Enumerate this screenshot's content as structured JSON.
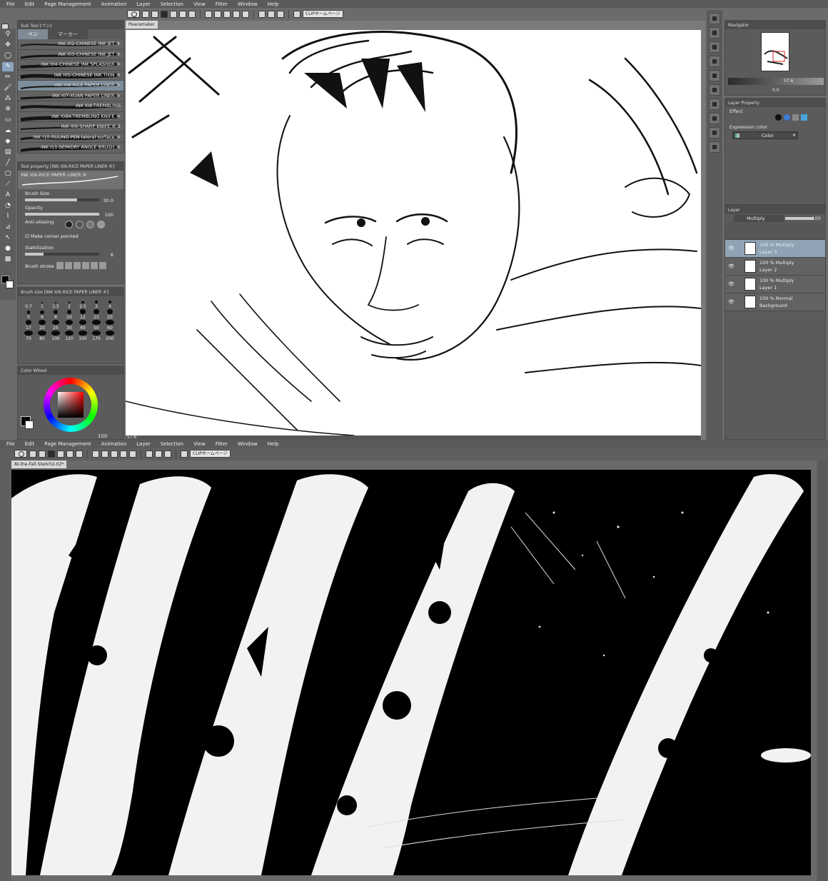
{
  "menu": [
    "File",
    "Edit",
    "Page Management",
    "Animation",
    "Layer",
    "Selection",
    "View",
    "Filter",
    "Window",
    "Help"
  ],
  "toolbar": {
    "clip_link": "CLIPホームページ"
  },
  "window1": {
    "doc_tab": "Peacemaker",
    "zoom": "57.6",
    "subtool_panel": {
      "title": "Sub Tool [ペン]",
      "tabs": [
        "ペン",
        "マーカー"
      ],
      "brushes": [
        "INK I02-CHINESE INK JET ®",
        "INK I03-CHINESE INK JET ®",
        "INK I04-CHINESE INK SPLASHER ®",
        "INK I05-CHINESE INK THIN ®",
        "INK I06-RICE PAPER LINER ®",
        "INK I07-XUAN PAPER LINER ®",
        "INK I08-TREMBLING",
        "INK I08A-TREMBLING KNIFE ®",
        "INK I09-SHARP KNIFE ® 2",
        "INK I10-RULING PEN lateral surface ®",
        "INK I11-SEMIDRY ANGLE BRUSH ®"
      ],
      "selected_index": 4
    },
    "tool_property": {
      "title": "Tool property [INK I06-RICE PAPER LINER ®]",
      "brush_name": "INK I06-RICE PAPER LINER ®",
      "brush_size_label": "Brush Size",
      "brush_size_value": "30.0",
      "brush_size_fraction": 0.7,
      "opacity_label": "Opacity",
      "opacity_value": "100",
      "opacity_fraction": 1.0,
      "antialias_label": "Anti-aliasing",
      "corner_label": "Make corner pointed",
      "stabilization_label": "Stabilization",
      "stabilization_value": "6",
      "stabilization_fraction": 0.25,
      "brush_stroke_label": "Brush stroke"
    },
    "brush_size_panel": {
      "title": "Brush size [INK I06-RICE PAPER LINER ®]",
      "sizes": [
        "0.7",
        "1",
        "1.5",
        "2",
        "2.5",
        "3",
        "4",
        "5",
        "6",
        "8",
        "10",
        "12",
        "15",
        "20",
        "17",
        "20",
        "25",
        "30",
        "40",
        "50",
        "60",
        "70",
        "80",
        "100",
        "120",
        "150",
        "170",
        "200"
      ]
    },
    "color_wheel": {
      "title": "Color Wheel",
      "value": "100"
    },
    "navigator": {
      "title": "Navigator",
      "zoom": "57.6",
      "angle": "0.0"
    },
    "layer_property": {
      "title": "Layer Property",
      "effect_label": "Effect",
      "expression_label": "Expression color",
      "expression_value": "Color"
    },
    "layer_panel": {
      "title": "Layer",
      "blend_mode": "Multiply",
      "opacity": "100",
      "layers": [
        {
          "opacity": "100 %",
          "mode": "Multiply",
          "name": "Layer 3"
        },
        {
          "opacity": "100 %",
          "mode": "Multiply",
          "name": "Layer 2"
        },
        {
          "opacity": "100 %",
          "mode": "Multiply",
          "name": "Layer 1"
        },
        {
          "opacity": "100 %",
          "mode": "Normal",
          "name": "Background"
        }
      ],
      "selected_index": 0
    }
  },
  "window2": {
    "doc_tab": "At-the-Fall-Sketch2-02*"
  }
}
